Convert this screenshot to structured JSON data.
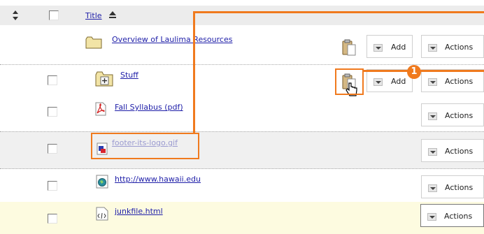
{
  "header": {
    "sort_label": "Title",
    "sort_icon": "sort-ascending-icon",
    "sort_handle_icon": "sort-updown-icon"
  },
  "items": [
    {
      "title": "Overview of Laulima Resources",
      "type_icon": "folder-icon",
      "paste": true,
      "add_label": "Add",
      "actions_label": "Actions"
    },
    {
      "title": "Stuff",
      "type_icon": "folder-plus-icon",
      "paste": true,
      "add_label": "Add",
      "actions_label": "Actions"
    },
    {
      "title": "Fall Syllabus (pdf)",
      "type_icon": "pdf-icon",
      "actions_label": "Actions"
    },
    {
      "title": "footer-its-logo.gif",
      "type_icon": "image-icon",
      "actions_label": "Actions"
    },
    {
      "title": "http://www.hawaii.edu",
      "type_icon": "web-link-icon",
      "actions_label": "Actions"
    },
    {
      "title": "junkfile.html",
      "type_icon": "html-file-icon",
      "actions_label": "Actions"
    }
  ],
  "callout": {
    "number": "1"
  },
  "colors": {
    "accent": "#f07a1e",
    "link": "#1e1ea8",
    "hidden_item": "#9a9ad0",
    "selected_row": "#fdfbe0"
  }
}
